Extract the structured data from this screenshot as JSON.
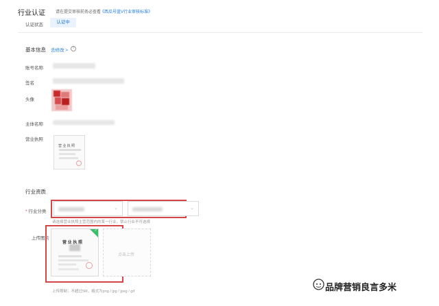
{
  "header": {
    "title": "行业认证",
    "subtitle": "请在提交审核前务必查看",
    "standard_link": "《西瓜号蓝V行业审核标准》",
    "status_label": "认证状态",
    "status_value": "认证中"
  },
  "basic_info": {
    "section_title": "基本信息",
    "edit_link": "去修改 >",
    "help": "?",
    "fields": [
      {
        "label": "账号名称"
      },
      {
        "label": "签名"
      },
      {
        "label": "头像"
      },
      {
        "label": "主体名称"
      },
      {
        "label": "营业执照"
      }
    ]
  },
  "license_thumb": {
    "title": "营 业 执 照"
  },
  "qualification": {
    "section_title": "行业资质",
    "category_label": "行业分类",
    "required_mark": "*",
    "hint": "请选择营业执照主营范围内的某一行业，禁止行业不可选择",
    "upload_label": "上传图片",
    "upload_card_title": "营 业 执 照",
    "upload_action": "点击上传",
    "limits": "上传限制：不超过5M，格式为png / jpg / jpeg / gif"
  },
  "watermark": {
    "text": "品牌营销良言多米"
  },
  "colors": {
    "accent": "#1f7be0",
    "highlight": "#d64545",
    "success": "#3cbf6b"
  }
}
